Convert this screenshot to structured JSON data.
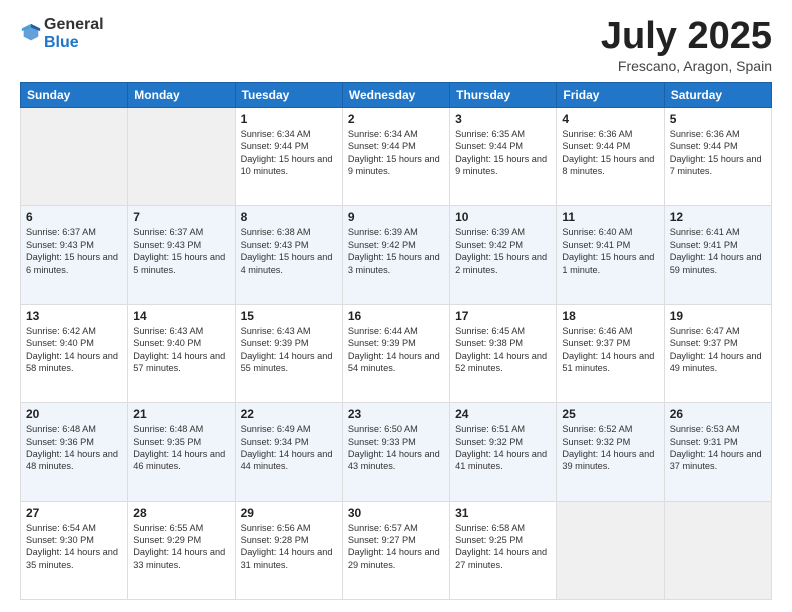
{
  "logo": {
    "general": "General",
    "blue": "Blue"
  },
  "header": {
    "month": "July 2025",
    "location": "Frescano, Aragon, Spain"
  },
  "weekdays": [
    "Sunday",
    "Monday",
    "Tuesday",
    "Wednesday",
    "Thursday",
    "Friday",
    "Saturday"
  ],
  "weeks": [
    [
      {
        "day": "",
        "empty": true
      },
      {
        "day": "",
        "empty": true
      },
      {
        "day": "1",
        "sunrise": "6:34 AM",
        "sunset": "9:44 PM",
        "daylight": "15 hours and 10 minutes."
      },
      {
        "day": "2",
        "sunrise": "6:34 AM",
        "sunset": "9:44 PM",
        "daylight": "15 hours and 9 minutes."
      },
      {
        "day": "3",
        "sunrise": "6:35 AM",
        "sunset": "9:44 PM",
        "daylight": "15 hours and 9 minutes."
      },
      {
        "day": "4",
        "sunrise": "6:36 AM",
        "sunset": "9:44 PM",
        "daylight": "15 hours and 8 minutes."
      },
      {
        "day": "5",
        "sunrise": "6:36 AM",
        "sunset": "9:44 PM",
        "daylight": "15 hours and 7 minutes."
      }
    ],
    [
      {
        "day": "6",
        "sunrise": "6:37 AM",
        "sunset": "9:43 PM",
        "daylight": "15 hours and 6 minutes."
      },
      {
        "day": "7",
        "sunrise": "6:37 AM",
        "sunset": "9:43 PM",
        "daylight": "15 hours and 5 minutes."
      },
      {
        "day": "8",
        "sunrise": "6:38 AM",
        "sunset": "9:43 PM",
        "daylight": "15 hours and 4 minutes."
      },
      {
        "day": "9",
        "sunrise": "6:39 AM",
        "sunset": "9:42 PM",
        "daylight": "15 hours and 3 minutes."
      },
      {
        "day": "10",
        "sunrise": "6:39 AM",
        "sunset": "9:42 PM",
        "daylight": "15 hours and 2 minutes."
      },
      {
        "day": "11",
        "sunrise": "6:40 AM",
        "sunset": "9:41 PM",
        "daylight": "15 hours and 1 minute."
      },
      {
        "day": "12",
        "sunrise": "6:41 AM",
        "sunset": "9:41 PM",
        "daylight": "14 hours and 59 minutes."
      }
    ],
    [
      {
        "day": "13",
        "sunrise": "6:42 AM",
        "sunset": "9:40 PM",
        "daylight": "14 hours and 58 minutes."
      },
      {
        "day": "14",
        "sunrise": "6:43 AM",
        "sunset": "9:40 PM",
        "daylight": "14 hours and 57 minutes."
      },
      {
        "day": "15",
        "sunrise": "6:43 AM",
        "sunset": "9:39 PM",
        "daylight": "14 hours and 55 minutes."
      },
      {
        "day": "16",
        "sunrise": "6:44 AM",
        "sunset": "9:39 PM",
        "daylight": "14 hours and 54 minutes."
      },
      {
        "day": "17",
        "sunrise": "6:45 AM",
        "sunset": "9:38 PM",
        "daylight": "14 hours and 52 minutes."
      },
      {
        "day": "18",
        "sunrise": "6:46 AM",
        "sunset": "9:37 PM",
        "daylight": "14 hours and 51 minutes."
      },
      {
        "day": "19",
        "sunrise": "6:47 AM",
        "sunset": "9:37 PM",
        "daylight": "14 hours and 49 minutes."
      }
    ],
    [
      {
        "day": "20",
        "sunrise": "6:48 AM",
        "sunset": "9:36 PM",
        "daylight": "14 hours and 48 minutes."
      },
      {
        "day": "21",
        "sunrise": "6:48 AM",
        "sunset": "9:35 PM",
        "daylight": "14 hours and 46 minutes."
      },
      {
        "day": "22",
        "sunrise": "6:49 AM",
        "sunset": "9:34 PM",
        "daylight": "14 hours and 44 minutes."
      },
      {
        "day": "23",
        "sunrise": "6:50 AM",
        "sunset": "9:33 PM",
        "daylight": "14 hours and 43 minutes."
      },
      {
        "day": "24",
        "sunrise": "6:51 AM",
        "sunset": "9:32 PM",
        "daylight": "14 hours and 41 minutes."
      },
      {
        "day": "25",
        "sunrise": "6:52 AM",
        "sunset": "9:32 PM",
        "daylight": "14 hours and 39 minutes."
      },
      {
        "day": "26",
        "sunrise": "6:53 AM",
        "sunset": "9:31 PM",
        "daylight": "14 hours and 37 minutes."
      }
    ],
    [
      {
        "day": "27",
        "sunrise": "6:54 AM",
        "sunset": "9:30 PM",
        "daylight": "14 hours and 35 minutes."
      },
      {
        "day": "28",
        "sunrise": "6:55 AM",
        "sunset": "9:29 PM",
        "daylight": "14 hours and 33 minutes."
      },
      {
        "day": "29",
        "sunrise": "6:56 AM",
        "sunset": "9:28 PM",
        "daylight": "14 hours and 31 minutes."
      },
      {
        "day": "30",
        "sunrise": "6:57 AM",
        "sunset": "9:27 PM",
        "daylight": "14 hours and 29 minutes."
      },
      {
        "day": "31",
        "sunrise": "6:58 AM",
        "sunset": "9:25 PM",
        "daylight": "14 hours and 27 minutes."
      },
      {
        "day": "",
        "empty": true
      },
      {
        "day": "",
        "empty": true
      }
    ]
  ],
  "labels": {
    "sunrise": "Sunrise:",
    "sunset": "Sunset:",
    "daylight": "Daylight:"
  }
}
